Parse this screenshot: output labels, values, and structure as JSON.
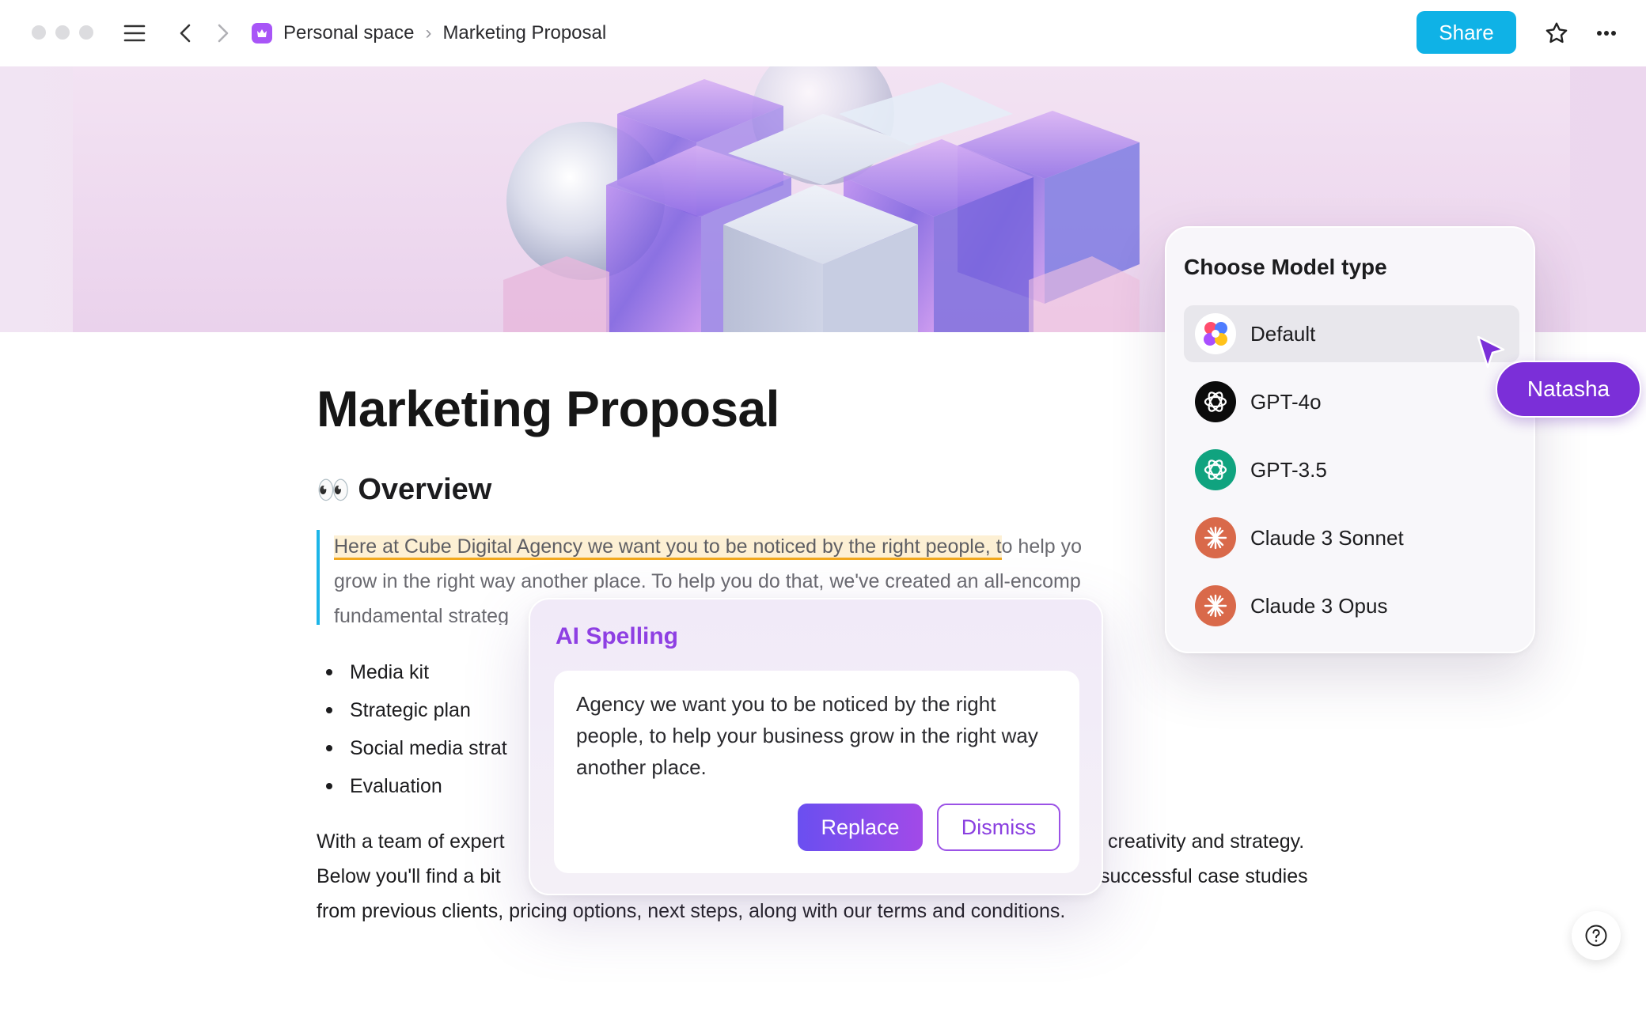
{
  "topbar": {
    "breadcrumb_space": "Personal space",
    "breadcrumb_page": "Marketing Proposal",
    "share_label": "Share"
  },
  "document": {
    "title": "Marketing Proposal",
    "overview_emoji": "👀",
    "overview_heading": "Overview",
    "quote_highlight": "Here at Cube Digital Agency we want you to be noticed by the right people, t",
    "quote_rest_line1": "o help yo",
    "quote_line2": "grow in the right way another place. To help you do that, we've created an all-encomp",
    "quote_line3": "fundamental strateg",
    "bullets": [
      "Media kit",
      "Strategic plan",
      "Social media strat",
      "Evaluation"
    ],
    "para_line1_left": "With a team of expert",
    "para_line1_right": "creativity and strategy.",
    "para_line2_left": "Below you'll find a bit",
    "para_line2_right": "successful case studies",
    "para_line3": "from previous clients, pricing options, next steps, along with our terms and conditions."
  },
  "ai_spelling": {
    "title": "AI Spelling",
    "suggestion": "Agency we want you to be noticed by the right people, to help your business grow in the right way another place.",
    "replace_label": "Replace",
    "dismiss_label": "Dismiss"
  },
  "model_chooser": {
    "title": "Choose Model type",
    "items": [
      {
        "label": "Default",
        "icon": "default-model-icon",
        "selected": true
      },
      {
        "label": "GPT-4o",
        "icon": "openai-icon"
      },
      {
        "label": "GPT-3.5",
        "icon": "openai-icon"
      },
      {
        "label": "Claude 3 Sonnet",
        "icon": "claude-icon"
      },
      {
        "label": "Claude 3 Opus",
        "icon": "claude-icon"
      }
    ]
  },
  "collaborator": {
    "name": "Natasha",
    "color": "#7b2fd8"
  },
  "colors": {
    "accent_share": "#0fb2e6",
    "ai_purple": "#8e3fe3",
    "quote_border": "#1cb5e8",
    "highlight_underline": "#f2a81d"
  }
}
